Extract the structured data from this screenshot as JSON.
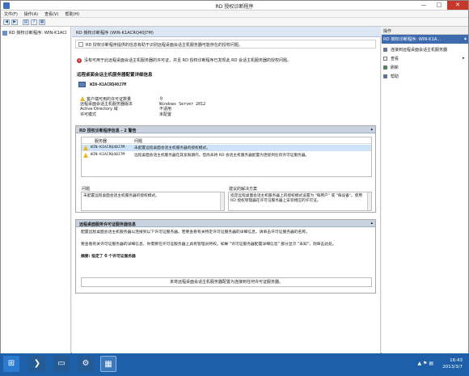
{
  "window": {
    "title": "RD 授权诊断程序",
    "min": "—",
    "max": "□",
    "close": "✕"
  },
  "menu": [
    "文件(F)",
    "操作(A)",
    "查看(V)",
    "帮助(H)"
  ],
  "toolbar": {
    "back": "◀",
    "forward": "▶",
    "b3": "▤",
    "b4": "?",
    "b5": "▦"
  },
  "tree": {
    "node": "RD 授权诊断程序: WIN-K1ACI"
  },
  "main": {
    "header": "RD 授权诊断程序 (WIN-K1ACRQ40J7M)",
    "info": "RD 授权诊断程序提供的信息有助于识别远程桌面会话主机服务器可能存在的授权问题。",
    "error": "没有可用于此远程桌面会话主机服务器的许可证，并且 RD 授权诊断程序已发现此 RD 会话主机服务器的授权问题。",
    "section_title": "远程桌面会话主机服务器配置详细信息",
    "host": "WIN-K1ACRQ40J7M",
    "details": [
      {
        "label": "客户端可用的许可证数量",
        "value": "0",
        "warn": true
      },
      {
        "label": "远程桌面会话主机服务器版本",
        "value": "Windows Server 2012",
        "warn": false
      },
      {
        "label": "Active Directory 域",
        "value": "不适用",
        "warn": false
      },
      {
        "label": "许可模式",
        "value": "未配置",
        "warn": false
      }
    ]
  },
  "panel2": {
    "title": "RD 授权诊断程序信息 - 2 警告",
    "col_server": "服务器",
    "col_issue": "问题",
    "rows": [
      {
        "server": "WIN-K1ACRQ40J7M",
        "issue": "未配置远程桌面会话主机服务器的授权模式。"
      },
      {
        "server": "WIN-K1ACRQ40J7M",
        "issue": "远程桌面会话主机服务器在其宽限期内，但尚未将 RD 会话主机服务器配置为连接到任何许可证服务器。"
      }
    ],
    "problem_label": "问题",
    "problem_text": "未配置远程桌面会话主机服务器的授权模式。",
    "solution_label": "建议的解决方案",
    "solution_text": "指定远程桌面会话主机服务器上的授权模式设置为 \"每用户\" 或 \"每设备\"。使用 RD 授权管理器在许可证服务器上安装相应的许可证。"
  },
  "panel3": {
    "title": "远程桌面服务许可证服务器信息",
    "p1": "配置远程桌面会话主机服务器以连接到以下许可证服务器。若要查看有关特定许可证服务器的详细信息，请单击许可证服务器的名称。",
    "p2": "要查看有关许可证服务器的详细信息，你需要在许可证服务器上具有管理员特权。如果 \"许可证服务器配置详细信息\" 部分显示 \"未知\"，则单击此处。",
    "summary": "摘要: 指定了 0 个许可证服务器",
    "empty": "未将远程桌面会话主机服务器配置为连接到任何许可证服务器。"
  },
  "actions": {
    "header": "操作",
    "sub": "RD 授权诊断程序: WIN-K1A...",
    "items": [
      {
        "label": "连接到远程桌面会话主机服务器",
        "color": "#4a7dc0"
      },
      {
        "label": "查看",
        "color": "#ffffff"
      },
      {
        "label": "刷新",
        "color": "#2e9a3a"
      },
      {
        "label": "帮助",
        "color": "#3f73c8"
      }
    ]
  },
  "taskbar": {
    "time": "16:43",
    "date": "2013/3/7",
    "tray": "▲ ⚑ ▤"
  }
}
